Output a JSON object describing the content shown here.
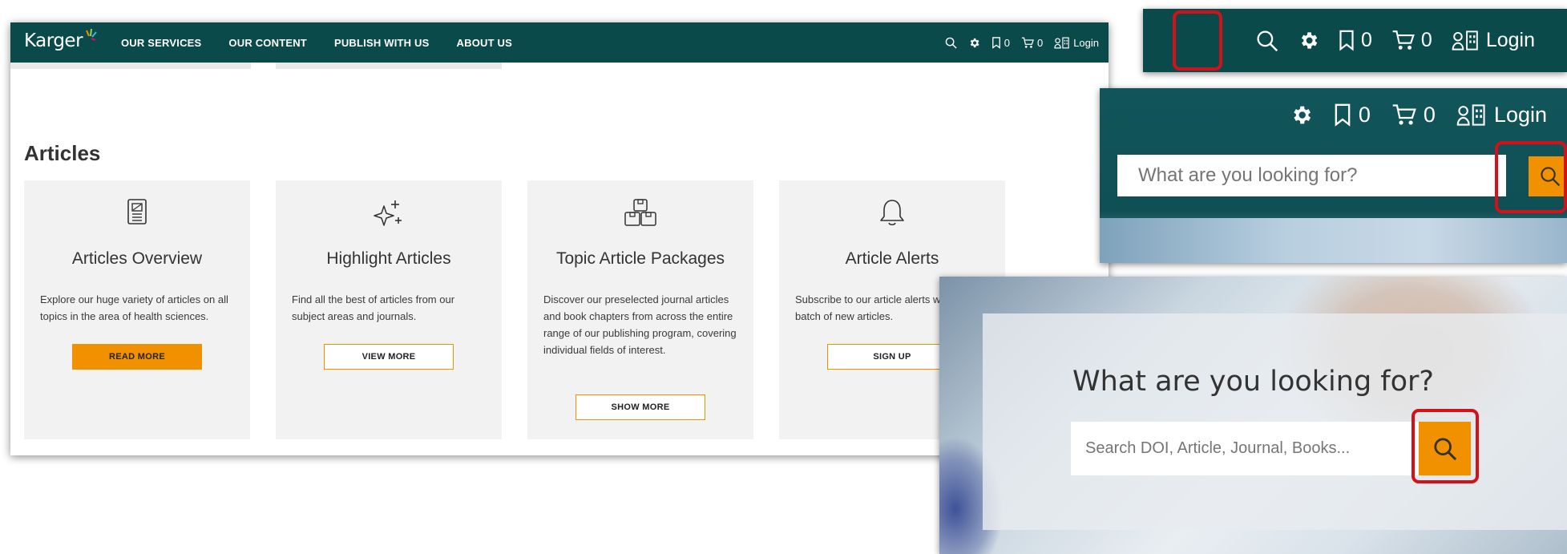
{
  "brand": {
    "logo_text": "Karger",
    "colors": {
      "nav_bg": "#0b4a4a",
      "accent": "#f29100",
      "highlight": "#d1121b",
      "card_bg": "#f2f2f2"
    }
  },
  "nav": {
    "links": [
      "OUR SERVICES",
      "OUR CONTENT",
      "PUBLISH WITH US",
      "ABOUT US"
    ],
    "bookmark_count": "0",
    "cart_count": "0",
    "login_label": "Login",
    "icons": [
      "search-icon",
      "gear-icon",
      "bookmark-icon",
      "cart-icon",
      "institution-login-icon"
    ]
  },
  "section": {
    "title": "Articles"
  },
  "cards": [
    {
      "icon": "document-icon",
      "title": "Articles Overview",
      "description": "Explore our huge variety of articles on all topics in the area of health sciences.",
      "button": "READ MORE",
      "primary": true
    },
    {
      "icon": "sparkle-icon",
      "title": "Highlight Articles",
      "description": "Find all the best of articles from our subject areas and journals.",
      "button": "VIEW MORE",
      "primary": false
    },
    {
      "icon": "packages-icon",
      "title": "Topic Article Packages",
      "description": "Discover our preselected journal articles and book chapters from across the entire range of our publishing program, covering individual fields of interest.",
      "button": "SHOW MORE",
      "primary": false
    },
    {
      "icon": "bell-icon",
      "title": "Article Alerts",
      "description": "Subscribe to our article alerts weekly batch of new articles.",
      "button": "SIGN UP",
      "primary": false
    }
  ],
  "inset_header": {
    "bookmark_count": "0",
    "cart_count": "0",
    "login_label": "Login"
  },
  "inset_search_bar": {
    "bookmark_count": "0",
    "cart_count": "0",
    "login_label": "Login",
    "placeholder": "What are you looking for?"
  },
  "inset_hero_search": {
    "heading": "What are you looking for?",
    "placeholder": "Search DOI, Article, Journal, Books..."
  }
}
